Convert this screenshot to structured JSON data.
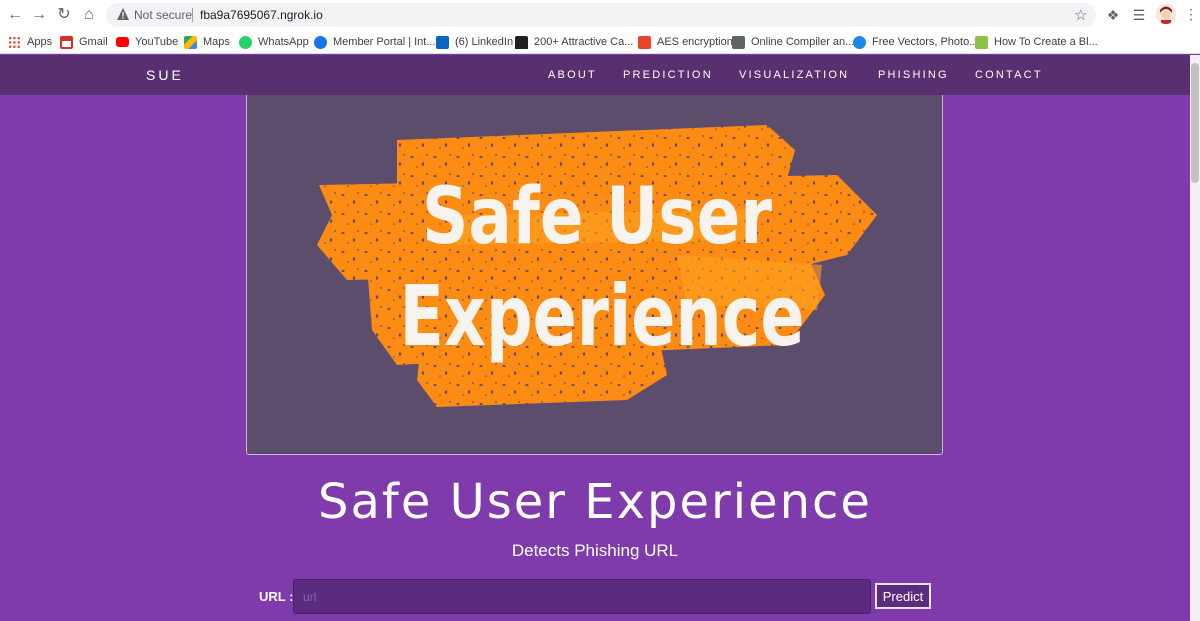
{
  "browser": {
    "security_label": "Not secure",
    "url": "fba9a7695067.ngrok.io",
    "bookmarks": [
      {
        "label": "Apps",
        "color": "#ea4335"
      },
      {
        "label": "Gmail",
        "color": "#d93025"
      },
      {
        "label": "YouTube",
        "color": "#ff0000"
      },
      {
        "label": "Maps",
        "color": "#34a853"
      },
      {
        "label": "WhatsApp",
        "color": "#25d366"
      },
      {
        "label": "Member Portal | Int...",
        "color": "#1a73e8"
      },
      {
        "label": "(6) LinkedIn",
        "color": "#0a66c2"
      },
      {
        "label": "200+ Attractive Ca...",
        "color": "#202124"
      },
      {
        "label": "AES encryption",
        "color": "#e8452c"
      },
      {
        "label": "Online Compiler an...",
        "color": "#5f6368"
      },
      {
        "label": "Free Vectors, Photo...",
        "color": "#1e88e5"
      },
      {
        "label": "How To Create a Bl...",
        "color": "#8bc34a"
      }
    ]
  },
  "site": {
    "brand": "SUE",
    "nav": [
      "ABOUT",
      "PREDICTION",
      "VISUALIZATION",
      "PHISHING",
      "CONTACT"
    ],
    "hero_text_line1": "Safe User",
    "hero_text_line2": "Experience",
    "title": "Safe User Experience",
    "subtitle": "Detects Phishing URL",
    "url_label": "URL :",
    "url_placeholder": "url",
    "predict_label": "Predict"
  },
  "colors": {
    "page_bg": "#7f3aab",
    "nav_bg": "#59306f",
    "hero_bg": "#5c4d6d",
    "brush_orange": "#ff8c12"
  }
}
